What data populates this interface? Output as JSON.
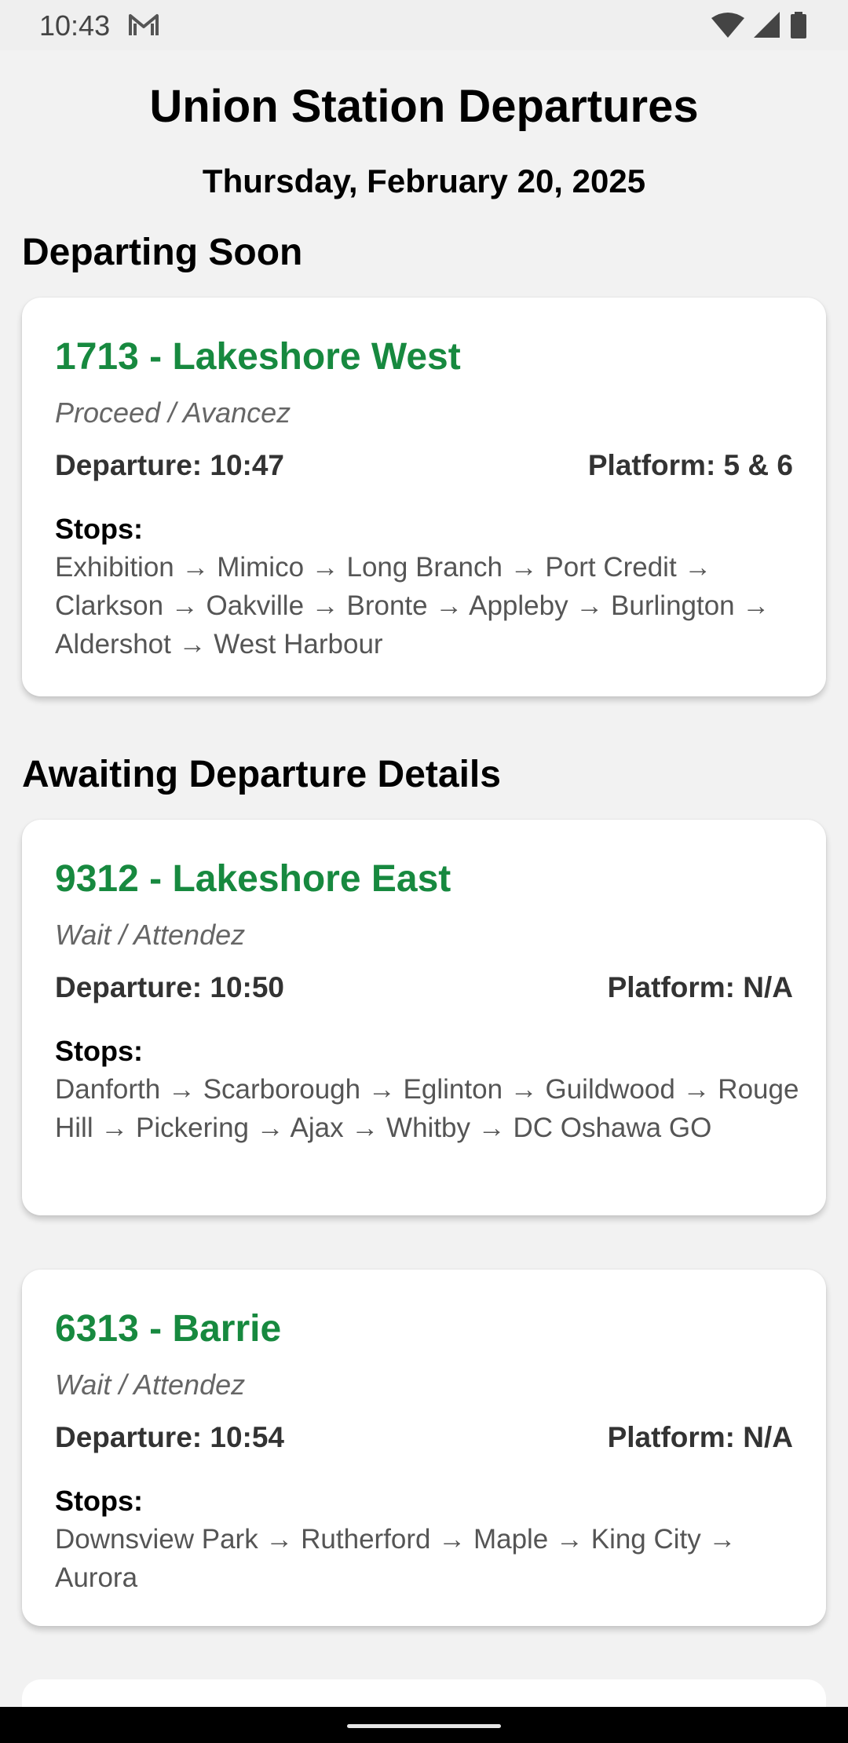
{
  "status_bar": {
    "time": "10:43",
    "icons": [
      "mail-icon",
      "wifi-icon",
      "signal-icon",
      "battery-icon"
    ]
  },
  "header": {
    "title": "Union Station Departures",
    "date": "Thursday, February 20, 2025"
  },
  "sections": [
    {
      "heading": "Departing Soon",
      "cards": [
        {
          "title": "1713 - Lakeshore West",
          "status": "Proceed / Avancez",
          "departure": "Departure: 10:47",
          "platform": "Platform: 5 & 6",
          "stops_label": "Stops:",
          "stops": "Exhibition → Mimico → Long Branch → Port Credit → Clarkson → Oakville → Bronte → Appleby → Burlington → Aldershot → West Harbour"
        }
      ]
    },
    {
      "heading": "Awaiting Departure Details",
      "cards": [
        {
          "title": "9312 - Lakeshore East",
          "status": "Wait / Attendez",
          "departure": "Departure: 10:50",
          "platform": "Platform: N/A",
          "stops_label": "Stops:",
          "stops": "Danforth → Scarborough → Eglinton → Guildwood → Rouge Hill → Pickering → Ajax → Whitby → DC Oshawa GO"
        },
        {
          "title": "6313 - Barrie",
          "status": "Wait / Attendez",
          "departure": "Departure: 10:54",
          "platform": "Platform: N/A",
          "stops_label": "Stops:",
          "stops": "Downsview Park → Rutherford → Maple → King City → Aurora"
        }
      ]
    }
  ],
  "colors": {
    "route_title": "#17893f",
    "background": "#f2f2f2",
    "card": "#ffffff"
  }
}
